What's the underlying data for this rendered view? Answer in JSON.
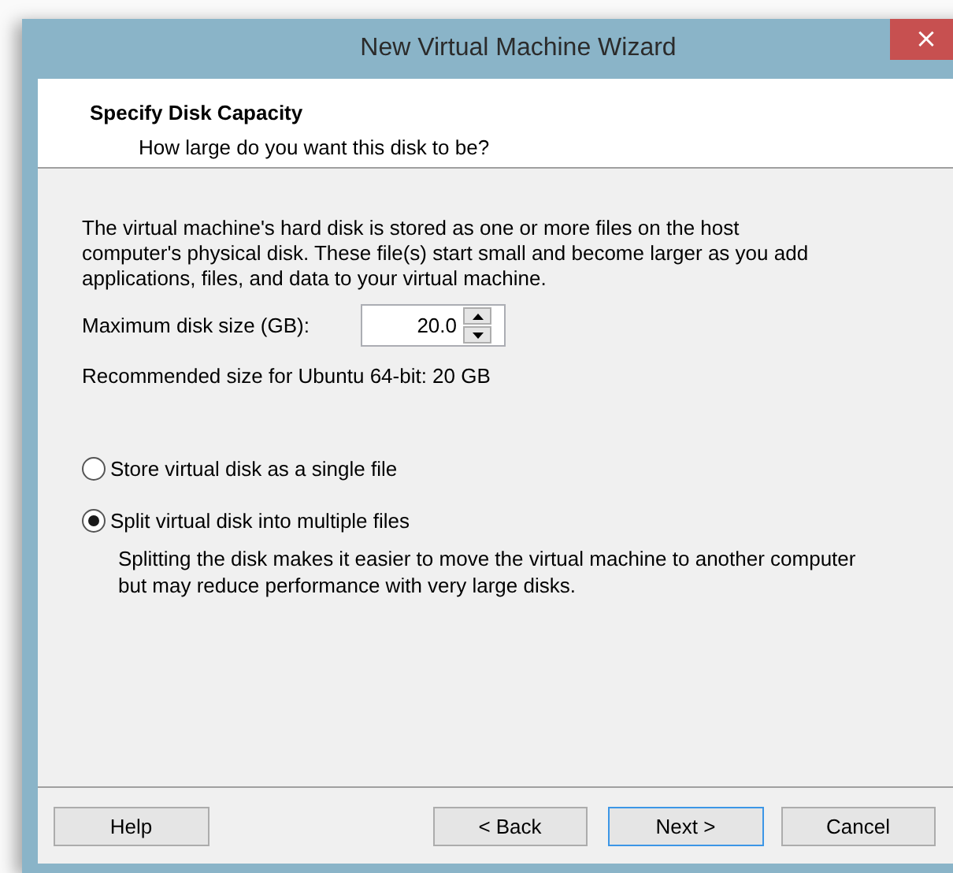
{
  "window": {
    "title": "New Virtual Machine Wizard",
    "close_icon": "×"
  },
  "header": {
    "title": "Specify Disk Capacity",
    "subtitle": "How large do you want this disk to be?"
  },
  "description": "The virtual machine's hard disk is stored as one or more files on the host computer's physical disk. These file(s) start small and become larger as you add applications, files, and data to your virtual machine.",
  "disk_size": {
    "label": "Maximum disk size (GB):",
    "value": "20.0"
  },
  "recommendation": "Recommended size for Ubuntu 64-bit: 20 GB",
  "options": [
    {
      "label": "Store virtual disk as a single file",
      "selected": false
    },
    {
      "label": "Split virtual disk into multiple files",
      "selected": true,
      "note": "Splitting the disk makes it easier to move the virtual machine to another computer but may reduce performance with very large disks."
    }
  ],
  "buttons": [
    {
      "label": "Help",
      "default": false
    },
    {
      "label": "< Back",
      "default": false
    },
    {
      "label": "Next >",
      "default": true
    },
    {
      "label": "Cancel",
      "default": false
    }
  ]
}
